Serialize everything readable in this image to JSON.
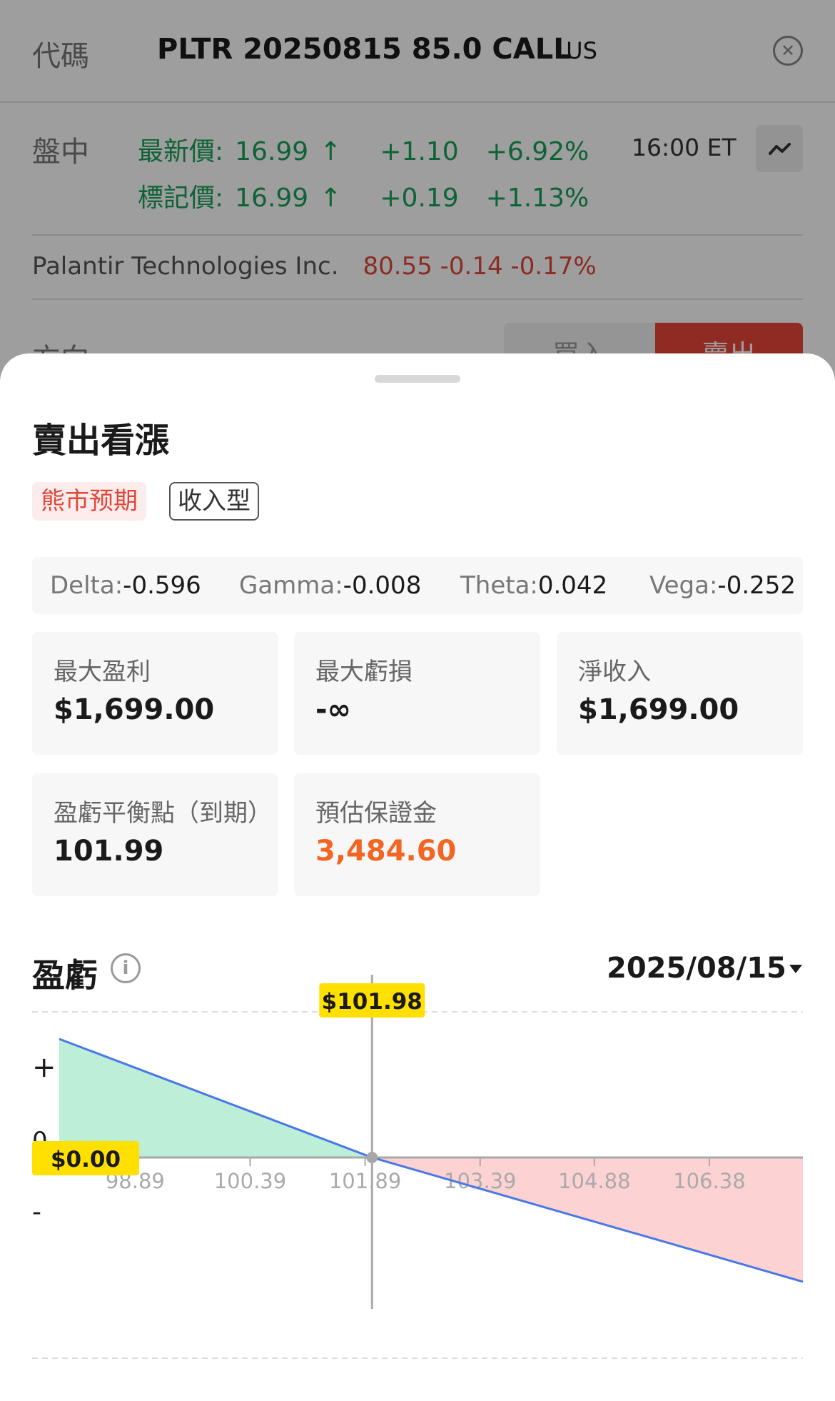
{
  "header": {
    "code_label": "代碼",
    "symbol": "PLTR 20250815 85.0 CALL",
    "market_suffix": ".US",
    "close_icon": "close-circle-icon"
  },
  "quote": {
    "session_label": "盤中",
    "last": {
      "label": "最新價:",
      "price": "16.99",
      "arrow": "↑",
      "change": "+1.10",
      "change_pct": "+6.92%"
    },
    "mark": {
      "label": "標記價:",
      "price": "16.99",
      "arrow": "↑",
      "change": "+0.19",
      "change_pct": "+1.13%"
    },
    "time": "16:00 ET",
    "chart_icon": "trend-icon",
    "up_color": "#18a058"
  },
  "underlying": {
    "name": "Palantir Technologies Inc.",
    "quote": "80.55 -0.14 -0.17%",
    "down_color": "#e0463a"
  },
  "direction": {
    "label": "方向",
    "buy": "買入",
    "sell": "賣出"
  },
  "sheet": {
    "title": "賣出看漲",
    "tags": [
      "熊市预期",
      "收入型"
    ],
    "greeks": [
      {
        "name": "Delta:",
        "value": "-0.596"
      },
      {
        "name": "Gamma:",
        "value": "-0.008"
      },
      {
        "name": "Theta:",
        "value": "0.042"
      },
      {
        "name": "Vega:",
        "value": "-0.252"
      }
    ],
    "metrics": [
      {
        "label": "最大盈利",
        "value": "$1,699.00"
      },
      {
        "label": "最大虧損",
        "value": "-∞"
      },
      {
        "label": "淨收入",
        "value": "$1,699.00"
      },
      {
        "label": "盈虧平衡點（到期）",
        "value": "101.99"
      },
      {
        "label": "預估保證金",
        "value": "3,484.60"
      }
    ],
    "pl_section": {
      "title": "盈虧",
      "info_icon": "info-icon",
      "expiry": "2025/08/15"
    }
  },
  "chart_data": {
    "type": "area",
    "x_ticks": [
      "98.89",
      "100.39",
      "101.89",
      "103.39",
      "104.88",
      "106.38"
    ],
    "y_labels": [
      "+",
      "0",
      "-"
    ],
    "crosshair_label": "$101.98",
    "zero_label": "$0.00",
    "series": [
      {
        "x": [
          97.9,
          101.98,
          107.6
        ],
        "y": [
          1699,
          0,
          -1699
        ]
      }
    ],
    "colors": {
      "line": "#4a78e6",
      "profit_fill": "#bdeed8",
      "loss_fill": "#fcd2d2",
      "badge": "#ffe000"
    }
  }
}
